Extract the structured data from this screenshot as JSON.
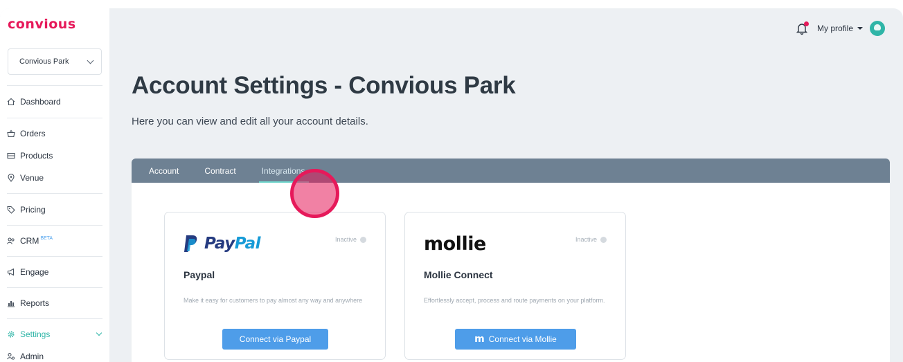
{
  "brand": {
    "logo": "convious",
    "accent": "#e6195a"
  },
  "venue_select": {
    "value": "Convious Park"
  },
  "sidebar": {
    "items": [
      {
        "label": "Dashboard",
        "icon": "home-icon"
      },
      {
        "label": "Orders",
        "icon": "basket-icon"
      },
      {
        "label": "Products",
        "icon": "ticket-icon"
      },
      {
        "label": "Venue",
        "icon": "location-icon"
      },
      {
        "label": "Pricing",
        "icon": "tag-icon"
      },
      {
        "label": "CRM",
        "badge": "BETA",
        "icon": "people-icon"
      },
      {
        "label": "Engage",
        "icon": "megaphone-icon"
      },
      {
        "label": "Reports",
        "icon": "reports-icon"
      },
      {
        "label": "Settings",
        "icon": "gear-icon",
        "active": true
      },
      {
        "label": "Admin",
        "icon": "admin-icon"
      }
    ]
  },
  "header": {
    "profile_label": "My profile"
  },
  "page": {
    "title": "Account Settings - Convious Park",
    "subtitle": "Here you can view and edit all your account details."
  },
  "tabs": [
    {
      "label": "Account"
    },
    {
      "label": "Contract"
    },
    {
      "label": "Integrations",
      "active": true
    }
  ],
  "integrations": [
    {
      "logo_text_1": "Pay",
      "logo_text_2": "Pal",
      "status": "Inactive",
      "name": "Paypal",
      "description": "Make it easy for customers to pay almost any way and anywhere",
      "button": "Connect via Paypal"
    },
    {
      "logo_text": "mollie",
      "status": "Inactive",
      "name": "Mollie Connect",
      "description": "Effortlessly accept, process and route payments on your platform.",
      "button": "Connect via Mollie"
    }
  ]
}
